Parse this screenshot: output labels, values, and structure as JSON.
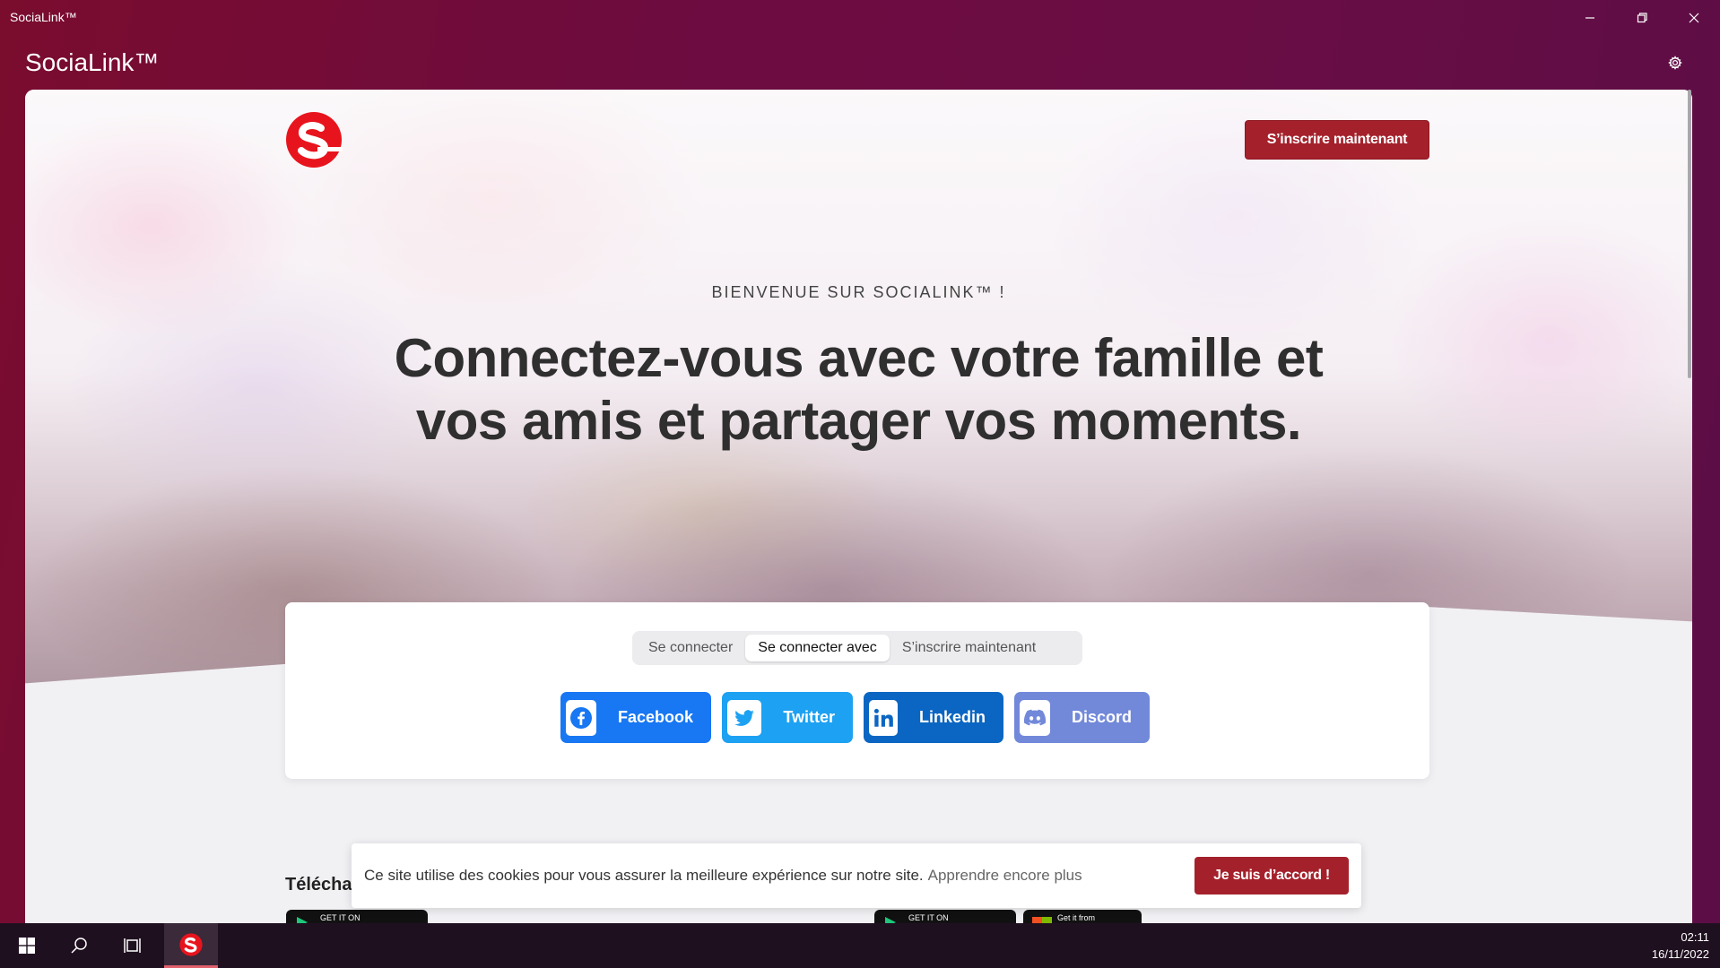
{
  "window": {
    "title": "SociaLink™",
    "controls": [
      "minimize-icon",
      "restore-icon",
      "close-icon"
    ]
  },
  "app": {
    "title": "SociaLink™",
    "settings_icon": "gear-icon"
  },
  "page": {
    "logo": "socialink-logo",
    "signup_top_label": "S’inscrire maintenant",
    "kicker": "BIENVENUE SUR SOCIALINK™ !",
    "headline": "Connectez-vous avec votre famille et vos amis et partager vos moments."
  },
  "auth": {
    "tabs": [
      {
        "label": "Se connecter",
        "active": false
      },
      {
        "label": "Se connecter avec",
        "active": true
      },
      {
        "label": "S’inscrire maintenant",
        "active": false
      }
    ],
    "social_buttons": [
      {
        "label": "Facebook",
        "icon": "facebook-icon",
        "color": "#1877f2"
      },
      {
        "label": "Twitter",
        "icon": "twitter-icon",
        "color": "#1da1f2"
      },
      {
        "label": "Linkedin",
        "icon": "linkedin-icon",
        "color": "#0a66c2"
      },
      {
        "label": "Discord",
        "icon": "discord-icon",
        "color": "#7289da"
      }
    ]
  },
  "download": {
    "label": "Télécha",
    "stores": [
      {
        "label": "GET IT ON",
        "icon": "google-play-icon"
      },
      {
        "label": "GET IT ON",
        "icon": "google-play-icon"
      },
      {
        "label": "Get it from",
        "icon": "microsoft-store-icon"
      }
    ]
  },
  "cookie": {
    "text": "Ce site utilise des cookies pour vous assurer la meilleure expérience sur notre site.",
    "link": "Apprendre encore plus",
    "accept_label": "Je suis d’accord !"
  },
  "taskbar": {
    "items": [
      "windows-start-icon",
      "search-icon",
      "task-view-icon",
      "socialink-app-icon"
    ],
    "time": "02:11",
    "date": "16/11/2022"
  },
  "colors": {
    "brand_red": "#a4212b",
    "window_bg": "#6d0c3f"
  }
}
